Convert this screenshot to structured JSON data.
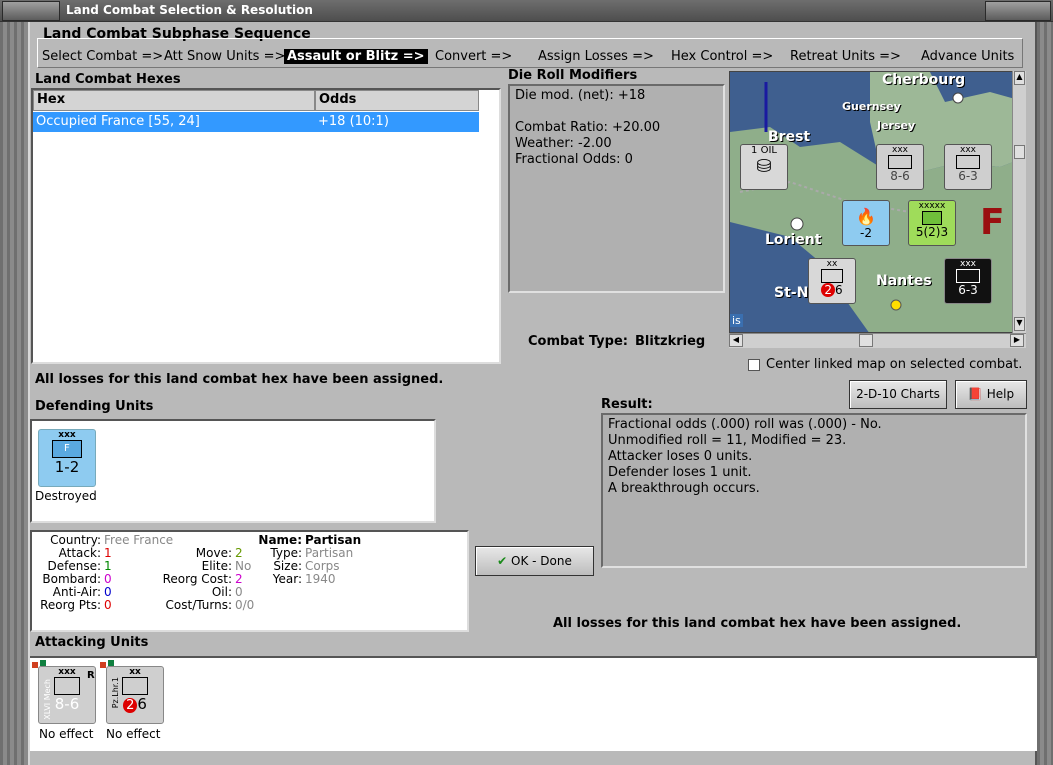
{
  "window": {
    "title": "Land Combat Selection & Resolution"
  },
  "subphase": {
    "label": "Land Combat Subphase Sequence",
    "steps": [
      "Select Combat =>",
      "Att Snow Units =>",
      "Assault or Blitz =>",
      "Convert =>",
      "Assign Losses =>",
      "Hex Control =>",
      "Retreat Units =>",
      "Advance Units"
    ],
    "active_index": 2
  },
  "hexes": {
    "label": "Land Combat Hexes",
    "columns": [
      "Hex",
      "Odds"
    ],
    "rows": [
      {
        "hex": "Occupied France [55, 24]",
        "odds": "+18 (10:1)"
      }
    ]
  },
  "modifiers": {
    "label": "Die Roll Modifiers",
    "lines": [
      "Die mod. (net): +18",
      "",
      "Combat Ratio: +20.00",
      "Weather: -2.00",
      "Fractional Odds: 0"
    ]
  },
  "combat_type": {
    "label": "Combat Type:",
    "value": "Blitzkrieg"
  },
  "center_map": {
    "label": "Center linked map on selected combat.",
    "checked": false
  },
  "buttons": {
    "charts": "2-D-10 Charts",
    "help": "Help",
    "ok": "OK - Done"
  },
  "losses_msg": "All losses for this land combat hex have been assigned.",
  "defending": {
    "label": "Defending Units",
    "units": [
      {
        "top": "xxx",
        "letter": "F",
        "strength": "1-2",
        "status": "Destroyed"
      }
    ]
  },
  "result": {
    "label": "Result:",
    "lines": [
      "Fractional odds (.000) roll was (.000)  - No.",
      "Unmodified roll = 11, Modified = 23.",
      "Attacker loses 0 units.",
      "Defender loses 1 unit.",
      "A breakthrough occurs."
    ]
  },
  "unit_info": {
    "country_k": "Country:",
    "country_v": "Free France",
    "attack_k": "Attack:",
    "attack_v": "1",
    "defense_k": "Defense:",
    "defense_v": "1",
    "bombard_k": "Bombard:",
    "bombard_v": "0",
    "antiair_k": "Anti-Air:",
    "antiair_v": "0",
    "reorgpts_k": "Reorg Pts:",
    "reorgpts_v": "0",
    "move_k": "Move:",
    "move_v": "2",
    "elite_k": "Elite:",
    "elite_v": "No",
    "reorgcost_k": "Reorg Cost:",
    "reorgcost_v": "2",
    "oil_k": "Oil:",
    "oil_v": "0",
    "costturns_k": "Cost/Turns:",
    "costturns_v": "0/0",
    "name_k": "Name:",
    "name_v": "Partisan",
    "type_k": "Type:",
    "type_v": "Partisan",
    "size_k": "Size:",
    "size_v": "Corps",
    "year_k": "Year:",
    "year_v": "1940"
  },
  "attacking": {
    "label": "Attacking Units",
    "units": [
      {
        "top": "xxx",
        "side": "XLVI Mech",
        "corner": "R",
        "strength": "8-6",
        "status": "No effect"
      },
      {
        "top": "xx",
        "side": "Pz.Lhr.1",
        "corner": "",
        "strength": "6",
        "badge": "2",
        "status": "No effect"
      }
    ]
  },
  "map": {
    "places": [
      "Cherbourg",
      "Guernsey",
      "Jersey",
      "Brest",
      "Lorient",
      "Nantes",
      "St-N",
      "F",
      "is"
    ],
    "counters": [
      {
        "id": "oil",
        "text": "1 OIL"
      },
      {
        "id": "c1",
        "top": "xxx",
        "strength": "8-6"
      },
      {
        "id": "c2",
        "top": "xxx",
        "strength": "6-3"
      },
      {
        "id": "c3",
        "strength": "-2"
      },
      {
        "id": "c4",
        "top": "xxxxx",
        "strength": "5(2)3"
      },
      {
        "id": "c5",
        "top": "xx",
        "badge": "2",
        "strength": "6"
      },
      {
        "id": "c6",
        "top": "xxx",
        "strength": "6-3"
      }
    ]
  }
}
